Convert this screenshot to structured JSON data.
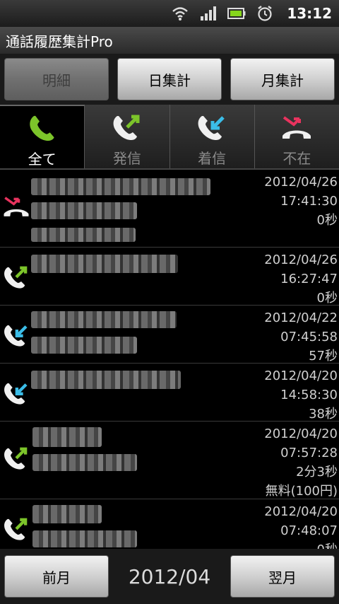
{
  "status_bar": {
    "time": "13:12"
  },
  "app": {
    "title": "通話履歴集計Pro"
  },
  "top_buttons": [
    {
      "label": "明細",
      "enabled": false
    },
    {
      "label": "日集計",
      "enabled": true
    },
    {
      "label": "月集計",
      "enabled": true
    }
  ],
  "tabs": [
    {
      "label": "全て",
      "icon": "all-calls-icon",
      "active": true
    },
    {
      "label": "発信",
      "icon": "outgoing-call-icon",
      "active": false
    },
    {
      "label": "着信",
      "icon": "incoming-call-icon",
      "active": false
    },
    {
      "label": "不在",
      "icon": "missed-call-icon",
      "active": false
    }
  ],
  "calls": [
    {
      "type": "missed",
      "date": "2012/04/26",
      "time": "17:41:30",
      "duration": "0秒"
    },
    {
      "type": "outgoing",
      "date": "2012/04/26",
      "time": "16:27:47",
      "duration": "0秒"
    },
    {
      "type": "incoming",
      "date": "2012/04/22",
      "time": "07:45:58",
      "duration": "57秒"
    },
    {
      "type": "incoming",
      "date": "2012/04/20",
      "time": "14:58:30",
      "duration": "38秒"
    },
    {
      "type": "outgoing",
      "date": "2012/04/20",
      "time": "07:57:28",
      "duration": "2分3秒",
      "note": "無料(100円)"
    },
    {
      "type": "outgoing",
      "date": "2012/04/20",
      "time": "07:48:07",
      "duration": "0秒"
    }
  ],
  "bottom_bar": {
    "prev_label": "前月",
    "month": "2012/04",
    "next_label": "翌月"
  },
  "colors": {
    "outgoing": "#7cc42a",
    "incoming": "#3bbde8",
    "missed": "#e8335e",
    "all": "#7cc42a"
  }
}
